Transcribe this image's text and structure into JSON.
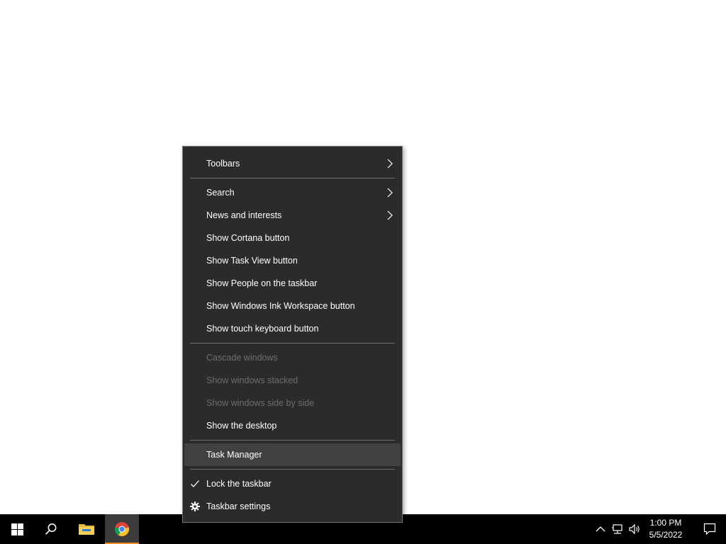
{
  "menu": {
    "items": [
      {
        "label": "Toolbars"
      },
      {
        "label": "Search"
      },
      {
        "label": "News and interests"
      },
      {
        "label": "Show Cortana button"
      },
      {
        "label": "Show Task View button"
      },
      {
        "label": "Show People on the taskbar"
      },
      {
        "label": "Show Windows Ink Workspace button"
      },
      {
        "label": "Show touch keyboard button"
      },
      {
        "label": "Cascade windows"
      },
      {
        "label": "Show windows stacked"
      },
      {
        "label": "Show windows side by side"
      },
      {
        "label": "Show the desktop"
      },
      {
        "label": "Task Manager"
      },
      {
        "label": "Lock the taskbar"
      },
      {
        "label": "Taskbar settings"
      }
    ],
    "colors": {
      "background": "#2b2b2b",
      "text": "#ffffff",
      "disabled": "#6d6d6d",
      "hover": "#414141"
    }
  },
  "taskbar": {
    "clock": {
      "time": "1:00 PM",
      "date": "5/5/2022"
    },
    "colors": {
      "background": "#000000",
      "active_indicator": "#f08a24"
    },
    "icons": [
      "windows-start-icon",
      "search-icon",
      "file-explorer-icon",
      "chrome-icon",
      "chevron-up-icon",
      "network-icon",
      "volume-icon",
      "notification-icon"
    ]
  }
}
